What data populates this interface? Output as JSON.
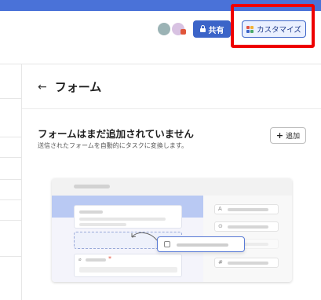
{
  "header": {
    "share_label": "共有",
    "customize_label": "カスタマイズ",
    "customize_icon_colors": [
      "#e25241",
      "#f2b233",
      "#3b64c8",
      "#49a96a"
    ]
  },
  "page": {
    "title": "フォーム",
    "back_icon": "←"
  },
  "empty_state": {
    "title": "フォームはまだ追加されていません",
    "subtitle": "送信されたフォームを自動的にタスクに変換します。",
    "add_button_label": "追加",
    "add_button_icon": "+"
  },
  "illustration": {
    "field_glyphs": [
      "A",
      "⊙",
      "#"
    ],
    "required_mark": "*"
  },
  "colors": {
    "topbar": "#4a72d8",
    "accent": "#3b64c8",
    "highlight": "#ee0000"
  }
}
